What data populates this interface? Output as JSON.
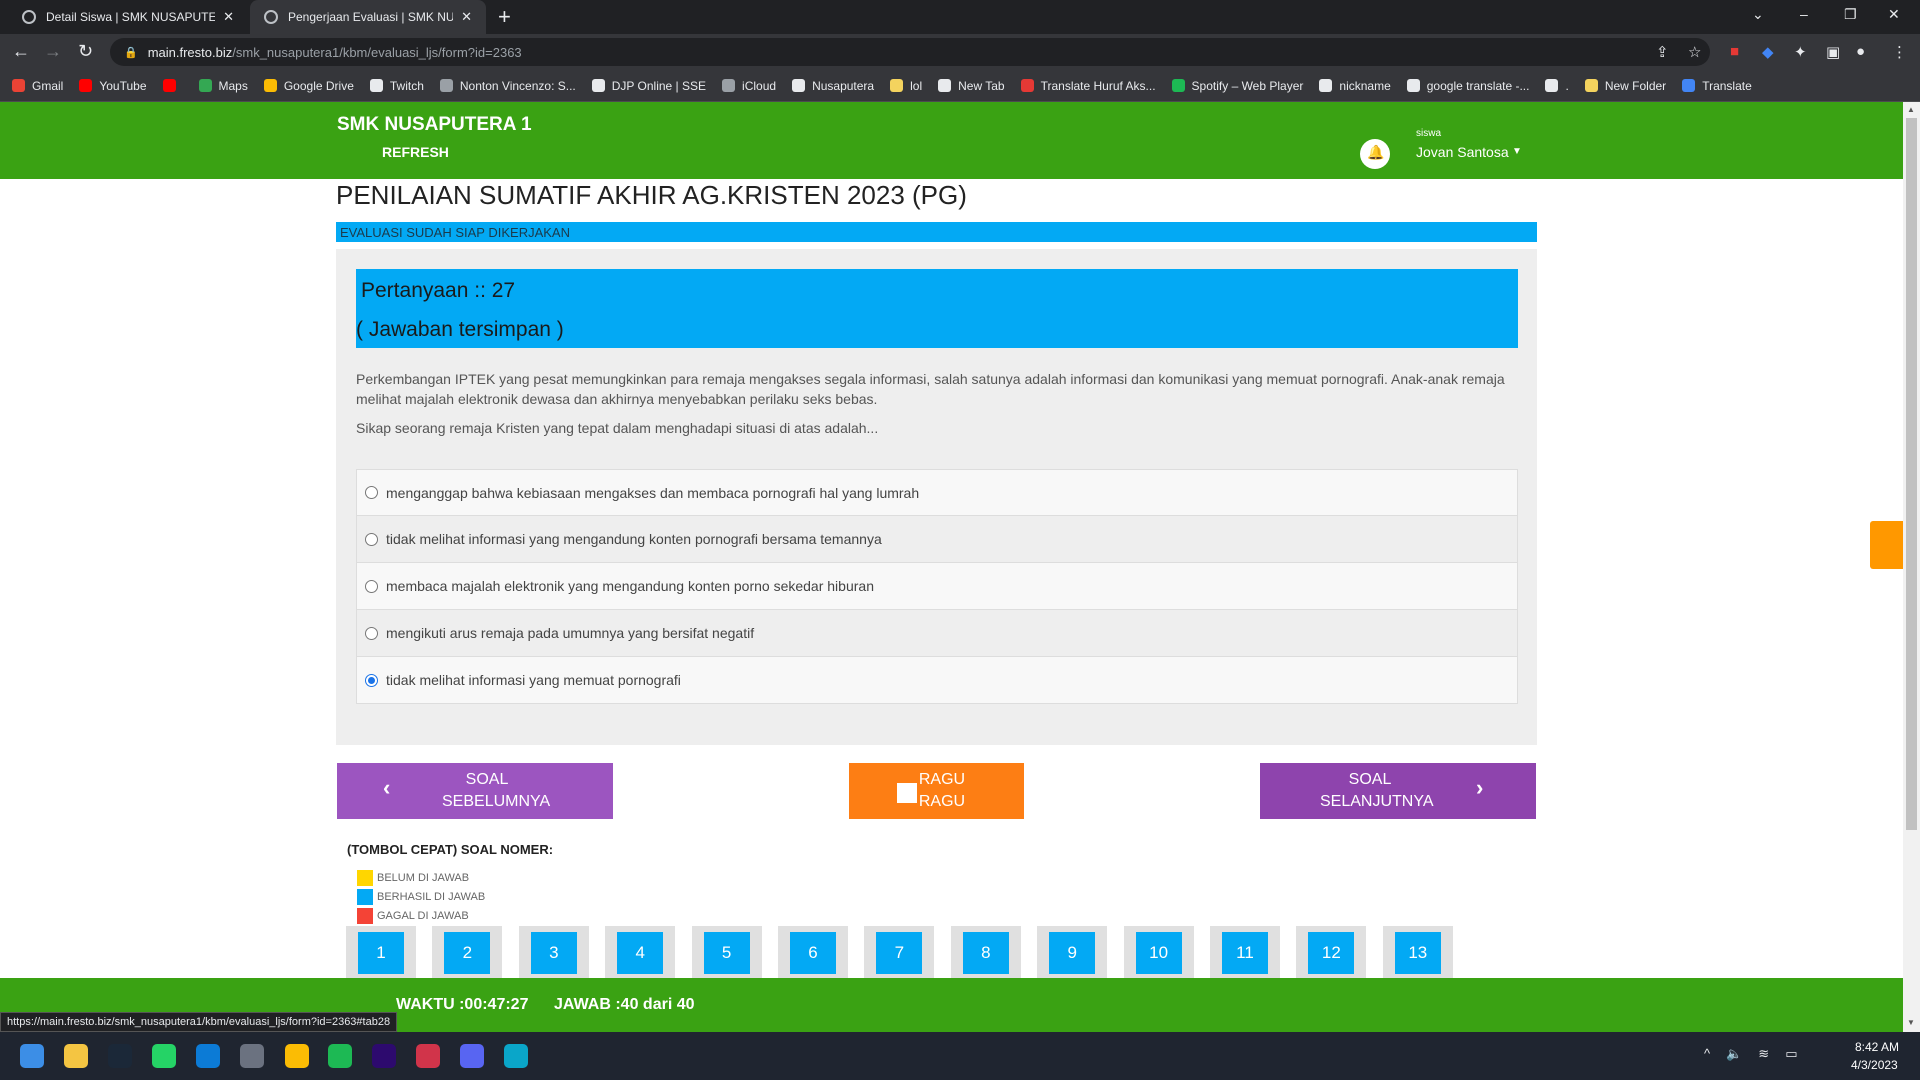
{
  "browser": {
    "tabs": [
      {
        "title": "Detail Siswa | SMK NUSAPUTERA",
        "active": false
      },
      {
        "title": "Pengerjaan Evaluasi | SMK NUSA",
        "active": true
      }
    ],
    "url_host": "main.fresto.biz",
    "url_path": "/smk_nusaputera1/kbm/evaluasi_ljs/form?id=2363",
    "bookmarks": [
      {
        "label": "Gmail",
        "color": "#ea4335"
      },
      {
        "label": "YouTube",
        "color": "#ff0000"
      },
      {
        "label": "",
        "color": "#ff0000"
      },
      {
        "label": "Maps",
        "color": "#34a853"
      },
      {
        "label": "Google Drive",
        "color": "#fbbc04"
      },
      {
        "label": "Twitch",
        "color": "#e8eaed"
      },
      {
        "label": "Nonton Vincenzo: S...",
        "color": "#9aa0a6"
      },
      {
        "label": "DJP Online | SSE",
        "color": "#e8eaed"
      },
      {
        "label": "iCloud",
        "color": "#9aa0a6"
      },
      {
        "label": "Nusaputera",
        "color": "#e8eaed"
      },
      {
        "label": "lol",
        "color": "#f4d35e"
      },
      {
        "label": "New Tab",
        "color": "#e8eaed"
      },
      {
        "label": "Translate Huruf Aks...",
        "color": "#e53935"
      },
      {
        "label": "Spotify – Web Player",
        "color": "#1db954"
      },
      {
        "label": "nickname",
        "color": "#e8eaed"
      },
      {
        "label": "google translate -...",
        "color": "#e8eaed"
      },
      {
        "label": ".",
        "color": "#e8eaed"
      },
      {
        "label": "New Folder",
        "color": "#f4d35e"
      },
      {
        "label": "Translate",
        "color": "#4285f4"
      }
    ],
    "status_url": "https://main.fresto.biz/smk_nusaputera1/kbm/evaluasi_ljs/form?id=2363#tab28"
  },
  "header": {
    "brand": "SMK NUSAPUTERA 1",
    "refresh": "REFRESH",
    "user_role": "siswa",
    "user_name": "Jovan Santosa"
  },
  "evaluation": {
    "title": "PENILAIAN SUMATIF AKHIR AG.KRISTEN 2023 (PG)",
    "ready_status": "EVALUASI SUDAH SIAP DIKERJAKAN"
  },
  "question": {
    "number_label": "Pertanyaan :: 27",
    "saved_status": "( Jawaban tersimpan )",
    "text": "Perkembangan IPTEK yang pesat memungkinkan para remaja mengakses segala informasi, salah satunya adalah informasi dan komunikasi yang memuat pornografi. Anak-anak remaja melihat majalah elektronik dewasa dan akhirnya menyebabkan perilaku seks bebas.",
    "prompt": "Sikap seorang remaja Kristen yang tepat dalam menghadapi situasi di atas adalah...",
    "options": [
      {
        "label": "menganggap bahwa kebiasaan mengakses dan membaca pornografi hal yang lumrah",
        "selected": false
      },
      {
        "label": "tidak melihat informasi yang mengandung konten pornografi bersama temannya",
        "selected": false
      },
      {
        "label": "membaca majalah elektronik yang mengandung konten porno sekedar hiburan",
        "selected": false
      },
      {
        "label": "mengikuti arus remaja pada umumnya yang bersifat negatif",
        "selected": false
      },
      {
        "label": "tidak melihat informasi yang memuat pornografi",
        "selected": true
      }
    ]
  },
  "navigation": {
    "prev_line1": "SOAL",
    "prev_line2": "SEBELUMNYA",
    "ragu_line1": "RAGU",
    "ragu_line2": "RAGU",
    "next_line1": "SOAL",
    "next_line2": "SELANJUTNYA"
  },
  "quick": {
    "title": "(TOMBOL CEPAT) SOAL NOMER:",
    "legend": [
      {
        "label": "BELUM DI JAWAB",
        "color": "#ffd600"
      },
      {
        "label": "BERHASIL DI JAWAB",
        "color": "#03a9f4"
      },
      {
        "label": "GAGAL DI JAWAB",
        "color": "#f44336"
      }
    ],
    "numbers": [
      "1",
      "2",
      "3",
      "4",
      "5",
      "6",
      "7",
      "8",
      "9",
      "10",
      "11",
      "12",
      "13"
    ]
  },
  "footer": {
    "timer": "WAKTU :00:47:27",
    "answered": "JAWAB :40 dari 40"
  },
  "taskbar": {
    "time": "8:42 AM",
    "date": "4/3/2023"
  },
  "colors": {
    "green": "#3aa213",
    "blue": "#03a9f4",
    "purple": "#9c55c0",
    "orange": "#fd7e14"
  }
}
